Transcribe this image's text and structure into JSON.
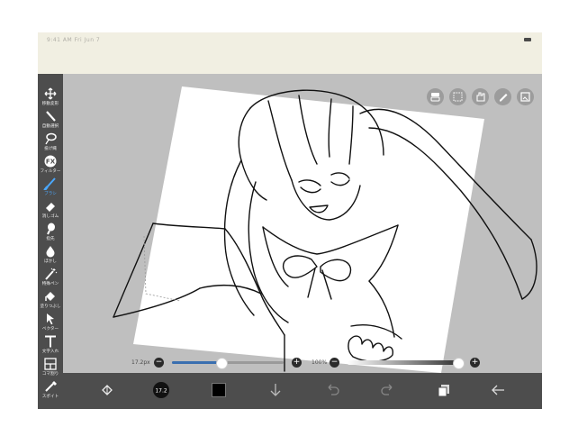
{
  "status_bar": {
    "text": "9:41 AM Fri Jun 7",
    "battery_icon": "battery-icon"
  },
  "tools": [
    {
      "label": "移動変形",
      "icon": "move-icon"
    },
    {
      "label": "自動選択",
      "icon": "magic-wand-icon"
    },
    {
      "label": "投げ縄",
      "icon": "lasso-icon"
    },
    {
      "label": "フィルター",
      "icon": "filter-fx-icon"
    },
    {
      "label": "ブラシ",
      "icon": "brush-icon",
      "active": true
    },
    {
      "label": "消しゴム",
      "icon": "eraser-icon"
    },
    {
      "label": "指先",
      "icon": "finger-smudge-icon"
    },
    {
      "label": "ぼかし",
      "icon": "blur-drop-icon"
    },
    {
      "label": "特殊ペン",
      "icon": "special-pen-icon"
    },
    {
      "label": "塗りつぶし",
      "icon": "bucket-fill-icon"
    },
    {
      "label": "ベクター",
      "icon": "vector-cursor-icon"
    },
    {
      "label": "文字入れ",
      "icon": "text-icon"
    },
    {
      "label": "コマ割り",
      "icon": "frame-divide-icon"
    },
    {
      "label": "スポイト",
      "icon": "eyedropper-icon"
    }
  ],
  "top_right_icons": [
    "layer-toggle-icon",
    "selection-icon",
    "hand-icon",
    "pen-icon",
    "save-icon"
  ],
  "brush_size": {
    "label": "17.2px",
    "value_fraction": 0.44
  },
  "opacity": {
    "label": "100%",
    "value_fraction": 1.0
  },
  "bottom_bar": {
    "brush_size_badge": "17.2",
    "items": [
      "layer-flip-icon",
      "brush-size-icon",
      "color-swatch-icon",
      "down-arrow-icon",
      "undo-icon",
      "redo-icon",
      "layers-icon",
      "back-arrow-icon"
    ]
  },
  "colors": {
    "sidebar_bg": "#4d4d4d",
    "canvas_bg": "#bfbfbf",
    "accent": "#3a6fb0",
    "status_bg": "#f1efe2"
  }
}
